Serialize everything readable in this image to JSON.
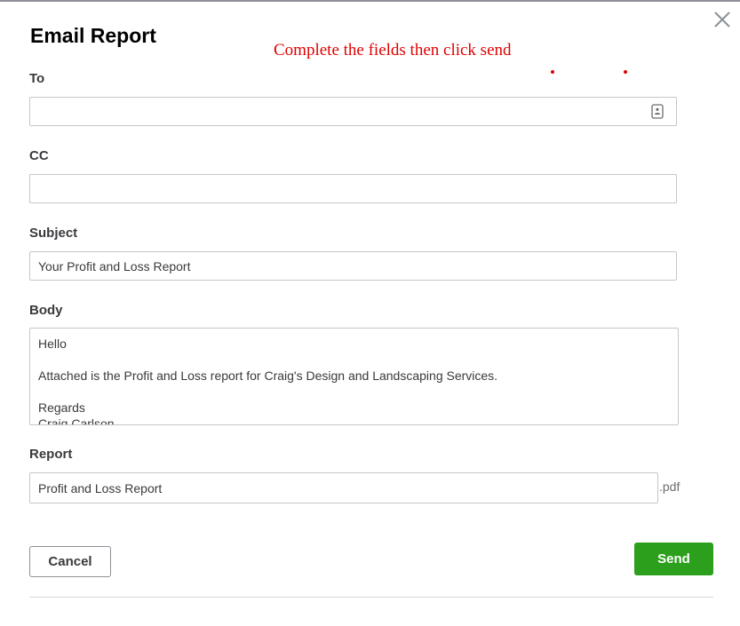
{
  "dialog": {
    "title": "Email Report",
    "annotation": "Complete the fields then click send"
  },
  "fields": {
    "to": {
      "label": "To",
      "value": "",
      "icon": "contact-card-icon"
    },
    "cc": {
      "label": "CC",
      "value": ""
    },
    "subject": {
      "label": "Subject",
      "value": "Your Profit and Loss Report"
    },
    "body": {
      "label": "Body",
      "lines": [
        "Hello",
        "Attached is the Profit and Loss report for Craig's Design and Landscaping Services.",
        "Regards",
        "Craig Carlson"
      ]
    },
    "report": {
      "label": "Report",
      "value": "Profit and Loss Report",
      "extension": ".pdf"
    }
  },
  "buttons": {
    "cancel": "Cancel",
    "send": "Send"
  },
  "colors": {
    "annotation": "#e10000",
    "send_button": "#2ca01c",
    "border": "#c4c6cb"
  },
  "icons": {
    "close": "close-icon",
    "contact": "contact-card-icon"
  }
}
